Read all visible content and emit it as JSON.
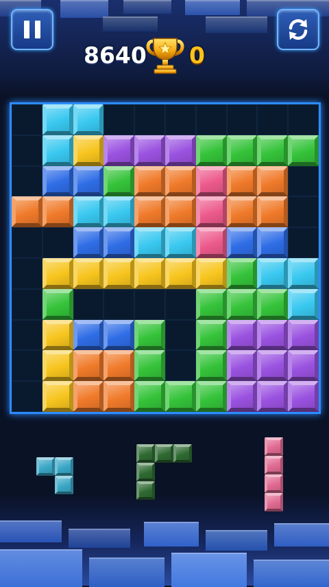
{
  "hud": {
    "score": "8640",
    "best_score": "0",
    "pause_icon": "pause-icon",
    "restart_icon": "restart-icon",
    "trophy_icon": "trophy-icon"
  },
  "colors": {
    "cyan": "#39c8f0",
    "yellow": "#f7c51e",
    "purple": "#9a52e0",
    "green": "#35c33a",
    "orange": "#f07a2a",
    "blue": "#2f6de6",
    "pink": "#ec5a8c",
    "tray_cyan": "#3aa7c6",
    "tray_green": "#2f6a32",
    "tray_pink": "#e06a92"
  },
  "board": {
    "rows": 10,
    "cols": 10,
    "grid": [
      [
        ".",
        "C",
        "C",
        ".",
        ".",
        ".",
        ".",
        ".",
        ".",
        "."
      ],
      [
        ".",
        "C",
        "Y",
        "P",
        "P",
        "P",
        "G",
        "G",
        "G",
        "G"
      ],
      [
        ".",
        "B",
        "B",
        "G",
        "O",
        "O",
        "K",
        "O",
        "O",
        "."
      ],
      [
        "O",
        "O",
        "C",
        "C",
        "O",
        "O",
        "K",
        "O",
        "O",
        "."
      ],
      [
        ".",
        ".",
        "B",
        "B",
        "C",
        "C",
        "K",
        "B",
        "B",
        "."
      ],
      [
        ".",
        "Y",
        "Y",
        "Y",
        "Y",
        "Y",
        "Y",
        "G",
        "C",
        "C"
      ],
      [
        ".",
        "G",
        ".",
        ".",
        ".",
        ".",
        "G",
        "G",
        "G",
        "C"
      ],
      [
        ".",
        "Y",
        "B",
        "B",
        "G",
        ".",
        "G",
        "P",
        "P",
        "P"
      ],
      [
        ".",
        "Y",
        "O",
        "O",
        "G",
        ".",
        "G",
        "P",
        "P",
        "P"
      ],
      [
        ".",
        "Y",
        "O",
        "O",
        "G",
        "G",
        "G",
        "P",
        "P",
        "P"
      ]
    ]
  },
  "tray": {
    "pieces": [
      {
        "name": "piece-cyan-s",
        "color": "tray_cyan",
        "cells": [
          [
            0,
            0
          ],
          [
            0,
            1
          ],
          [
            1,
            1
          ]
        ]
      },
      {
        "name": "piece-green-l",
        "color": "tray_green",
        "cells": [
          [
            0,
            0
          ],
          [
            0,
            1
          ],
          [
            0,
            2
          ],
          [
            1,
            0
          ],
          [
            2,
            0
          ]
        ]
      },
      {
        "name": "piece-pink-line",
        "color": "tray_pink",
        "cells": [
          [
            0,
            0
          ],
          [
            1,
            0
          ],
          [
            2,
            0
          ],
          [
            3,
            0
          ]
        ]
      }
    ]
  }
}
